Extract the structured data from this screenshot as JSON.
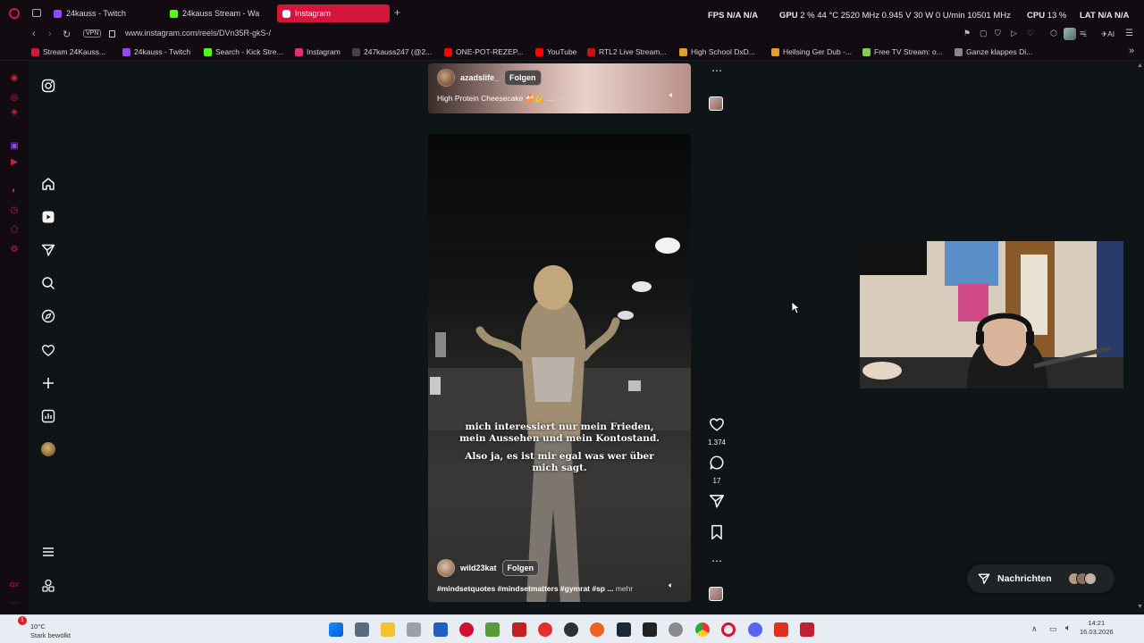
{
  "browser": {
    "tabs": [
      {
        "label": "24kauss - Twitch",
        "color": "#9146ff"
      },
      {
        "label": "24kauss Stream - Wa",
        "color": "#53fc18"
      },
      {
        "label": "Instagram",
        "color": "#e1306c",
        "active": true
      }
    ],
    "new_tab": "+",
    "hw_fps_label": "FPS",
    "hw_fps_val": "N/A  N/A",
    "hw_gpu_label": "GPU",
    "hw_gpu_val": "2 %  44 °C 2520 MHz 0.945 V 30 W 0 U/min 10501 MHz",
    "hw_cpu_label": "CPU",
    "hw_cpu_val": "13 %",
    "hw_lat_label": "LAT",
    "hw_lat_val": "N/A  N/A",
    "vpn_label": "VPN",
    "url": "www.instagram.com/reels/DVn35R-gkS-/",
    "ai_label": "AI"
  },
  "bookmarks": [
    {
      "label": "Stream 24Kauss...",
      "color": "#d4163c"
    },
    {
      "label": "24kauss - Twitch",
      "color": "#9146ff"
    },
    {
      "label": "Search - Kick Stre...",
      "color": "#53fc18"
    },
    {
      "label": "Instagram",
      "color": "#e1306c"
    },
    {
      "label": "247kauss247 (@2...",
      "color": "#222222"
    },
    {
      "label": "ONE-POT-REZEP...",
      "color": "#ff0000"
    },
    {
      "label": "YouTube",
      "color": "#ff0000"
    },
    {
      "label": "RTL2 Live Stream...",
      "color": "#cc1111"
    },
    {
      "label": "High School DxD...",
      "color": "#e0a030"
    },
    {
      "label": "Hellsing Ger Dub -...",
      "color": "#e0a030"
    },
    {
      "label": "Free TV Stream: o...",
      "color": "#88cc44"
    },
    {
      "label": "Ganze klappes Di...",
      "color": "#888888"
    }
  ],
  "ig_nav": {
    "items": [
      "instagram-logo",
      "home",
      "reels",
      "messages",
      "search",
      "explore",
      "notifications",
      "create",
      "dashboard",
      "profile",
      "more",
      "also-from-meta"
    ]
  },
  "reel_top": {
    "username": "azadslife_",
    "follow": "Folgen",
    "caption": "High Protein Cheesecake 🍰💪 ...",
    "more": "mehr"
  },
  "reel_main": {
    "subtitle_line1": "mich interessiert nur mein Frieden,",
    "subtitle_line2": "mein Aussehen und mein Kontostand.",
    "subtitle_line3": "Also ja, es ist mir egal was wer über",
    "subtitle_line4": "mich sagt.",
    "username": "wild23kat",
    "follow": "Folgen",
    "caption": "#mindsetquotes #mindsetmatters #gymrat #sp ...",
    "more": "mehr",
    "likes": "1.374",
    "comments": "17"
  },
  "messages": {
    "label": "Nachrichten"
  },
  "taskbar": {
    "weather_temp": "10°C",
    "weather_desc": "Stark bewölkt",
    "time": "14:21",
    "date": "16.03.2026",
    "notification_badge": "1"
  }
}
